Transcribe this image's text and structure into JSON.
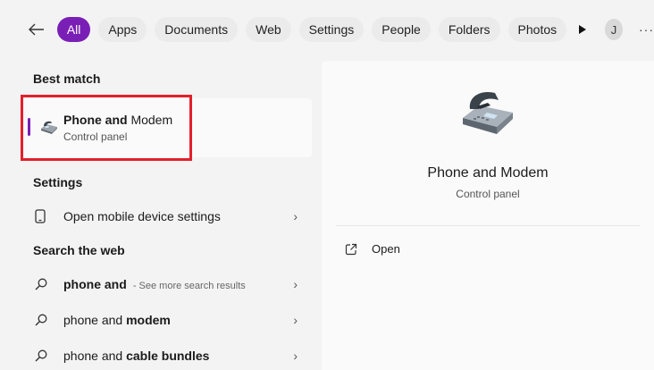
{
  "filters": {
    "tabs": [
      {
        "label": "All",
        "active": true
      },
      {
        "label": "Apps"
      },
      {
        "label": "Documents"
      },
      {
        "label": "Web"
      },
      {
        "label": "Settings"
      },
      {
        "label": "People"
      },
      {
        "label": "Folders"
      },
      {
        "label": "Photos"
      }
    ],
    "avatar_initial": "J",
    "more_label": "···"
  },
  "best_match": {
    "heading": "Best match",
    "title_bold": "Phone and",
    "title_rest": " Modem",
    "subtitle": "Control panel"
  },
  "settings": {
    "heading": "Settings",
    "items": [
      {
        "label": "Open mobile device settings"
      }
    ]
  },
  "web": {
    "heading": "Search the web",
    "items": [
      {
        "plain": "",
        "bold": "phone and",
        "suffix": " - See more search results"
      },
      {
        "plain": "phone and ",
        "bold": "modem",
        "suffix": ""
      },
      {
        "plain": "phone and ",
        "bold": "cable bundles",
        "suffix": ""
      }
    ]
  },
  "preview": {
    "title": "Phone and Modem",
    "subtitle": "Control panel",
    "open_label": "Open"
  },
  "colors": {
    "accent": "#7a1fb5",
    "highlight": "#e2202b"
  }
}
